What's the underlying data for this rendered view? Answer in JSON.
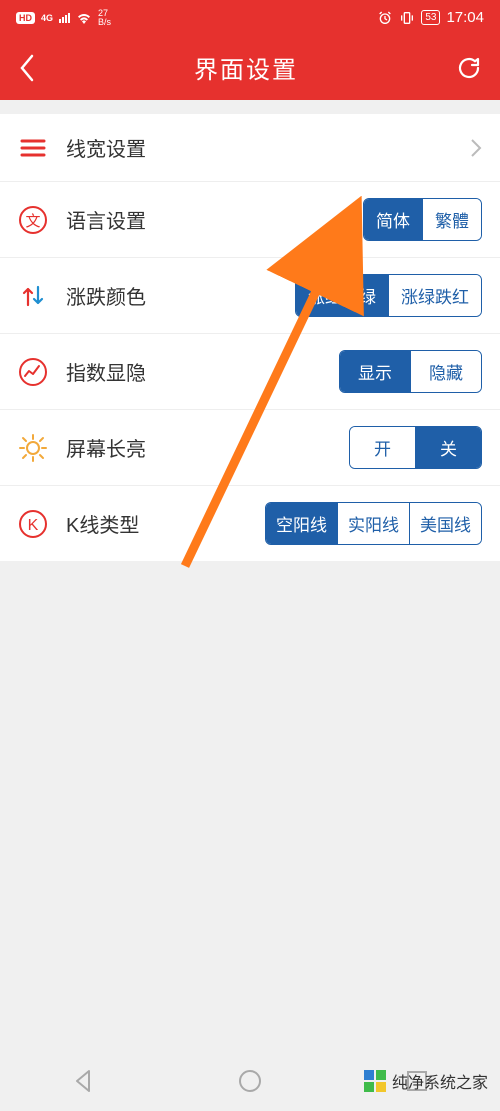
{
  "status": {
    "hd": "HD",
    "net_4g": "4G",
    "speed_num": "27",
    "speed_unit": "B/s",
    "battery": "53",
    "time": "17:04"
  },
  "header": {
    "title": "界面设置"
  },
  "rows": {
    "line_width": {
      "label": "线宽设置"
    },
    "language": {
      "label": "语言设置",
      "opt1": "简体",
      "opt2": "繁體"
    },
    "updown_color": {
      "label": "涨跌颜色",
      "opt1": "涨红跌绿",
      "opt2": "涨绿跌红"
    },
    "index_visible": {
      "label": "指数显隐",
      "opt1": "显示",
      "opt2": "隐藏"
    },
    "screen_on": {
      "label": "屏幕长亮",
      "opt1": "开",
      "opt2": "关"
    },
    "kline_type": {
      "label": "K线类型",
      "opt1": "空阳线",
      "opt2": "实阳线",
      "opt3": "美国线"
    }
  },
  "watermark": "纯净系统之家"
}
